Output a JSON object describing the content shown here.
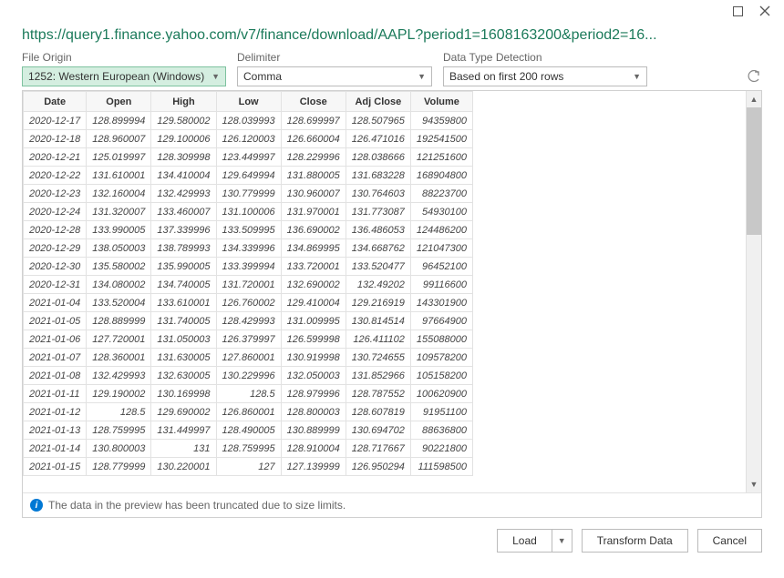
{
  "title_url": "https://query1.finance.yahoo.com/v7/finance/download/AAPL?period1=1608163200&period2=16...",
  "ctrls": {
    "origin_label": "File Origin",
    "origin_value": "1252: Western European (Windows)",
    "delim_label": "Delimiter",
    "delim_value": "Comma",
    "dtd_label": "Data Type Detection",
    "dtd_value": "Based on first 200 rows"
  },
  "columns": [
    "Date",
    "Open",
    "High",
    "Low",
    "Close",
    "Adj Close",
    "Volume"
  ],
  "rows": [
    [
      "2020-12-17",
      "128.899994",
      "129.580002",
      "128.039993",
      "128.699997",
      "128.507965",
      "94359800"
    ],
    [
      "2020-12-18",
      "128.960007",
      "129.100006",
      "126.120003",
      "126.660004",
      "126.471016",
      "192541500"
    ],
    [
      "2020-12-21",
      "125.019997",
      "128.309998",
      "123.449997",
      "128.229996",
      "128.038666",
      "121251600"
    ],
    [
      "2020-12-22",
      "131.610001",
      "134.410004",
      "129.649994",
      "131.880005",
      "131.683228",
      "168904800"
    ],
    [
      "2020-12-23",
      "132.160004",
      "132.429993",
      "130.779999",
      "130.960007",
      "130.764603",
      "88223700"
    ],
    [
      "2020-12-24",
      "131.320007",
      "133.460007",
      "131.100006",
      "131.970001",
      "131.773087",
      "54930100"
    ],
    [
      "2020-12-28",
      "133.990005",
      "137.339996",
      "133.509995",
      "136.690002",
      "136.486053",
      "124486200"
    ],
    [
      "2020-12-29",
      "138.050003",
      "138.789993",
      "134.339996",
      "134.869995",
      "134.668762",
      "121047300"
    ],
    [
      "2020-12-30",
      "135.580002",
      "135.990005",
      "133.399994",
      "133.720001",
      "133.520477",
      "96452100"
    ],
    [
      "2020-12-31",
      "134.080002",
      "134.740005",
      "131.720001",
      "132.690002",
      "132.49202",
      "99116600"
    ],
    [
      "2021-01-04",
      "133.520004",
      "133.610001",
      "126.760002",
      "129.410004",
      "129.216919",
      "143301900"
    ],
    [
      "2021-01-05",
      "128.889999",
      "131.740005",
      "128.429993",
      "131.009995",
      "130.814514",
      "97664900"
    ],
    [
      "2021-01-06",
      "127.720001",
      "131.050003",
      "126.379997",
      "126.599998",
      "126.411102",
      "155088000"
    ],
    [
      "2021-01-07",
      "128.360001",
      "131.630005",
      "127.860001",
      "130.919998",
      "130.724655",
      "109578200"
    ],
    [
      "2021-01-08",
      "132.429993",
      "132.630005",
      "130.229996",
      "132.050003",
      "131.852966",
      "105158200"
    ],
    [
      "2021-01-11",
      "129.190002",
      "130.169998",
      "128.5",
      "128.979996",
      "128.787552",
      "100620900"
    ],
    [
      "2021-01-12",
      "128.5",
      "129.690002",
      "126.860001",
      "128.800003",
      "128.607819",
      "91951100"
    ],
    [
      "2021-01-13",
      "128.759995",
      "131.449997",
      "128.490005",
      "130.889999",
      "130.694702",
      "88636800"
    ],
    [
      "2021-01-14",
      "130.800003",
      "131",
      "128.759995",
      "128.910004",
      "128.717667",
      "90221800"
    ],
    [
      "2021-01-15",
      "128.779999",
      "130.220001",
      "127",
      "127.139999",
      "126.950294",
      "111598500"
    ]
  ],
  "trunc_msg": "The data in the preview has been truncated due to size limits.",
  "footer": {
    "load": "Load",
    "transform": "Transform Data",
    "cancel": "Cancel"
  }
}
